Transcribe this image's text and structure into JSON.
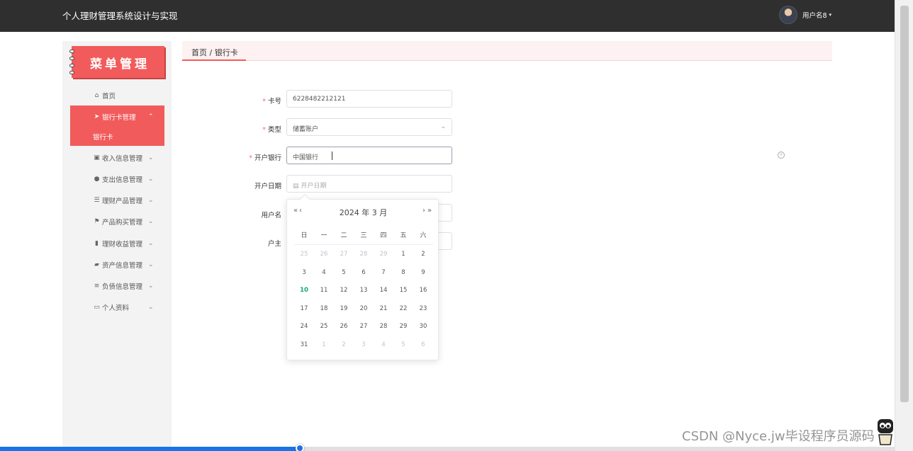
{
  "header": {
    "app_title": "个人理财管理系统设计与实现",
    "username": "用户名8",
    "caret": "▾"
  },
  "sidebar": {
    "title": "菜单管理",
    "items": [
      {
        "label": "首页",
        "icon": "home-icon",
        "glyph": "⌂"
      },
      {
        "label": "银行卡管理",
        "icon": "send-icon",
        "glyph": "➤",
        "chevron": "⌃"
      },
      {
        "label": "银行卡",
        "icon": ""
      },
      {
        "label": "收入信息管理",
        "icon": "clipboard-icon",
        "glyph": "▣",
        "chevron": "⌄"
      },
      {
        "label": "支出信息管理",
        "icon": "user-icon",
        "glyph": "●",
        "chevron": "⌄"
      },
      {
        "label": "理财产品管理",
        "icon": "sliders-icon",
        "glyph": "☰",
        "chevron": "⌄"
      },
      {
        "label": "产品购买管理",
        "icon": "flag-icon",
        "glyph": "⚑",
        "chevron": "⌄"
      },
      {
        "label": "理财收益管理",
        "icon": "bar-chart-icon",
        "glyph": "▮",
        "chevron": "⌄"
      },
      {
        "label": "资产信息管理",
        "icon": "thumbs-up-icon",
        "glyph": "▰",
        "chevron": "⌄"
      },
      {
        "label": "负债信息管理",
        "icon": "list-icon",
        "glyph": "≡",
        "chevron": "⌄"
      },
      {
        "label": "个人资料",
        "icon": "id-card-icon",
        "glyph": "▭",
        "chevron": "⌄"
      }
    ]
  },
  "breadcrumb": "首页 / 银行卡",
  "form": {
    "required_mark": "*",
    "card_no": {
      "label": "卡号",
      "value": "6228482212121"
    },
    "type": {
      "label": "类型",
      "value": "储蓄账户"
    },
    "bank": {
      "label": "开户银行",
      "value": "中国银行"
    },
    "open_date": {
      "label": "开户日期",
      "placeholder": "开户日期"
    },
    "username": {
      "label": "用户名"
    },
    "owner": {
      "label": "户主"
    }
  },
  "datepicker": {
    "prev_year": "«",
    "prev_month": "‹",
    "next_month": "›",
    "next_year": "»",
    "title": "2024 年  3 月",
    "weekdays": [
      "日",
      "一",
      "二",
      "三",
      "四",
      "五",
      "六"
    ],
    "weeks": [
      [
        "25",
        "26",
        "27",
        "28",
        "29",
        "1",
        "2"
      ],
      [
        "3",
        "4",
        "5",
        "6",
        "7",
        "8",
        "9"
      ],
      [
        "10",
        "11",
        "12",
        "13",
        "14",
        "15",
        "16"
      ],
      [
        "17",
        "18",
        "19",
        "20",
        "21",
        "22",
        "23"
      ],
      [
        "24",
        "25",
        "26",
        "27",
        "28",
        "29",
        "30"
      ],
      [
        "31",
        "1",
        "2",
        "3",
        "4",
        "5",
        "6"
      ]
    ],
    "today": "10"
  },
  "watermark": "CSDN @Nyce.jw毕设程序员源码",
  "colors": {
    "accent": "#f25b5b",
    "topbar": "#2f2f2f",
    "today": "#17a673",
    "progress": "#1a73e8"
  },
  "video_progress_fraction": 0.335
}
